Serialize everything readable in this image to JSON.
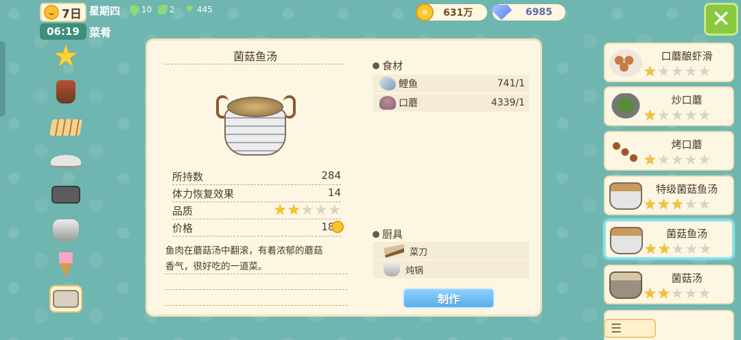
{
  "status": {
    "day": "7日",
    "time": "06:19",
    "weekday": "星期四",
    "page_label": "菜肴",
    "stats": {
      "water": "10",
      "sprout": "2",
      "heart": "445"
    }
  },
  "currency": {
    "gold": "631万",
    "diamond": "6985"
  },
  "detail": {
    "title": "菌菇鱼汤",
    "owned_label": "所持数",
    "owned_value": "284",
    "stamina_label": "体力恢复效果",
    "stamina_value": "14",
    "quality_label": "品质",
    "quality_stars": 2,
    "price_label": "价格",
    "price_value": "180",
    "description_line1": "鱼肉在蘑菇汤中翻滚，有着浓郁的蘑菇",
    "description_line2": "香气，很好吃的一道菜。",
    "ingredients_header": "食材",
    "ingredients": [
      {
        "name": "鲤鱼",
        "count": "741/1"
      },
      {
        "name": "口蘑",
        "count": "4339/1"
      }
    ],
    "tools_header": "厨具",
    "tools": [
      {
        "name": "菜刀"
      },
      {
        "name": "炖锅"
      }
    ],
    "make_button": "制作"
  },
  "recipes": [
    {
      "name": "口蘑酿虾滑",
      "stars": 1
    },
    {
      "name": "炒口蘑",
      "stars": 1
    },
    {
      "name": "烤口蘑",
      "stars": 1
    },
    {
      "name": "特级菌菇鱼汤",
      "stars": 3
    },
    {
      "name": "菌菇鱼汤",
      "stars": 2
    },
    {
      "name": "菌菇汤",
      "stars": 2
    }
  ],
  "colors": {
    "accent_blue": "#58aee8",
    "close_green": "#8ac93f",
    "star_gold": "#f2c230"
  }
}
